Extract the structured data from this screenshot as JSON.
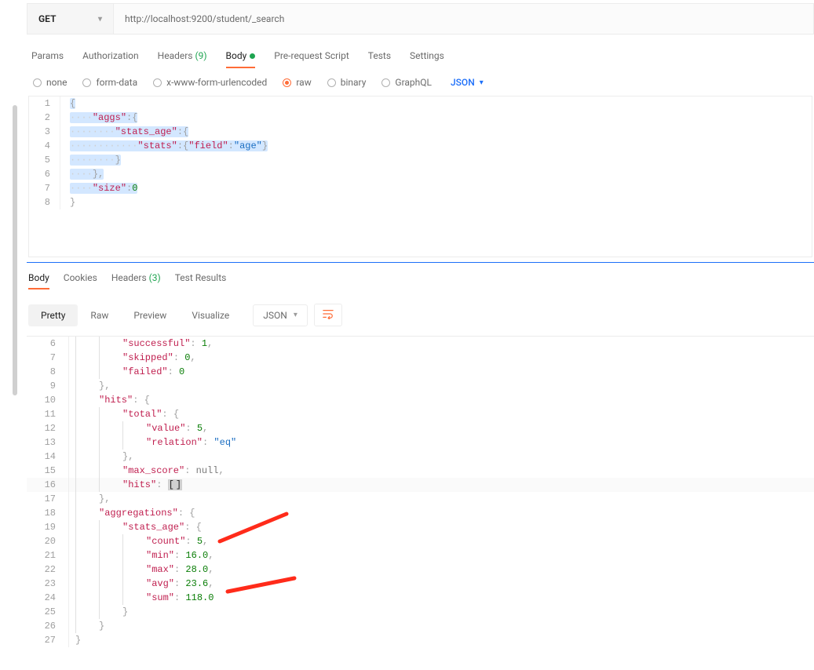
{
  "request": {
    "method": "GET",
    "url": "http://localhost:9200/student/_search"
  },
  "req_tabs": {
    "params": "Params",
    "authorization": "Authorization",
    "headers_label": "Headers",
    "headers_count": "(9)",
    "body": "Body",
    "prereq": "Pre-request Script",
    "tests": "Tests",
    "settings": "Settings"
  },
  "body_types": {
    "none": "none",
    "formdata": "form-data",
    "xwww": "x-www-form-urlencoded",
    "raw": "raw",
    "binary": "binary",
    "graphql": "GraphQL",
    "subtype": "JSON"
  },
  "req_body_lines": [
    "{",
    "    \"aggs\":{",
    "        \"stats_age\":{",
    "            \"stats\":{\"field\":\"age\"}",
    "        }",
    "    },",
    "    \"size\":0",
    "}"
  ],
  "resp_tabs": {
    "body": "Body",
    "cookies": "Cookies",
    "headers_label": "Headers",
    "headers_count": "(3)",
    "testresults": "Test Results"
  },
  "resp_toolbar": {
    "pretty": "Pretty",
    "raw": "Raw",
    "preview": "Preview",
    "visualize": "Visualize",
    "format": "JSON"
  },
  "resp_lines": {
    "6": "        \"successful\": 1,",
    "7": "        \"skipped\": 0,",
    "8": "        \"failed\": 0",
    "9": "    },",
    "10": "    \"hits\": {",
    "11": "        \"total\": {",
    "12": "            \"value\": 5,",
    "13": "            \"relation\": \"eq\"",
    "14": "        },",
    "15": "        \"max_score\": null,",
    "16": "        \"hits\": []",
    "17": "    },",
    "18": "    \"aggregations\": {",
    "19": "        \"stats_age\": {",
    "20": "            \"count\": 5,",
    "21": "            \"min\": 16.0,",
    "22": "            \"max\": 28.0,",
    "23": "            \"avg\": 23.6,",
    "24": "            \"sum\": 118.0",
    "25": "        }",
    "26": "    }",
    "27": "}"
  }
}
